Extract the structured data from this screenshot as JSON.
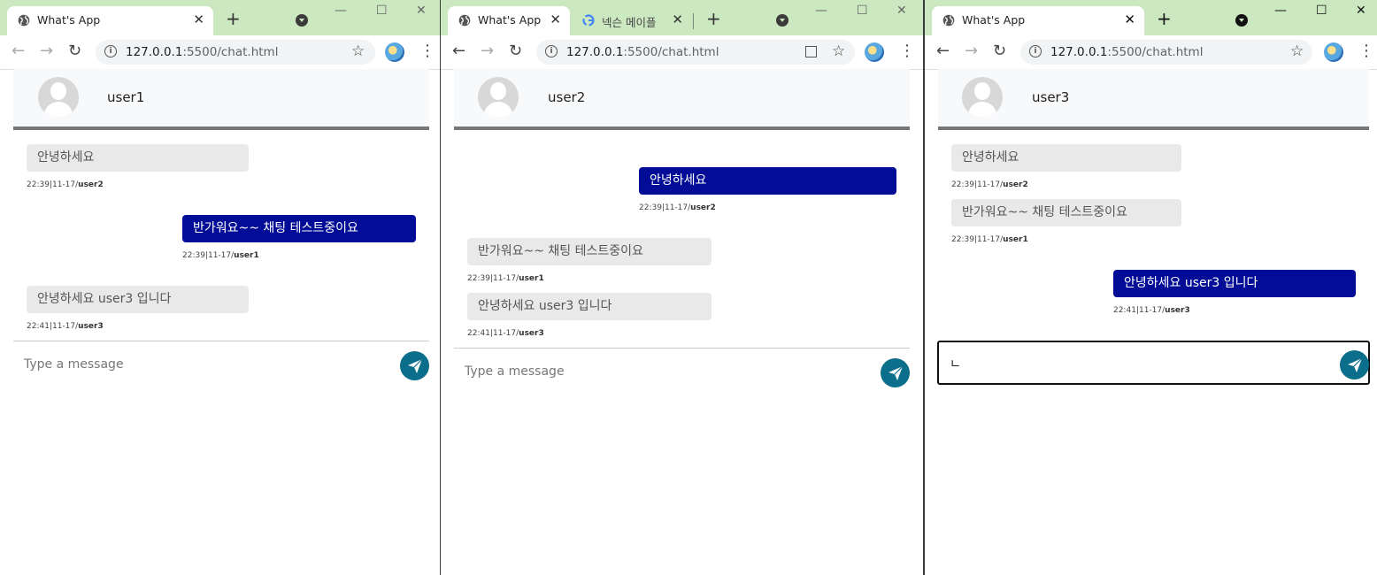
{
  "windows": [
    {
      "tabs": [
        {
          "title": "What's App",
          "close": "✕"
        }
      ],
      "url_host": "127.0.0.1",
      "url_rest": ":5500/chat.html",
      "user": "user1",
      "messages": [
        {
          "dir": "in",
          "text": "안녕하세요",
          "time": "22:39|11-17/",
          "sender": "user2"
        },
        {
          "dir": "out",
          "text": "반가워요~~ 채팅 테스트중이요",
          "time": "22:39|11-17/",
          "sender": "user1"
        },
        {
          "dir": "in",
          "text": "안녕하세요 user3 입니다",
          "time": "22:41|11-17/",
          "sender": "user3"
        }
      ],
      "input_value": "",
      "input_placeholder": "Type a message"
    },
    {
      "tabs": [
        {
          "title": "What's App",
          "close": "✕"
        },
        {
          "title": "넥슨 메이플",
          "close": "✕"
        }
      ],
      "url_host": "127.0.0.1",
      "url_rest": ":5500/chat.html",
      "user": "user2",
      "messages": [
        {
          "dir": "out",
          "text": "안녕하세요",
          "time": "22:39|11-17/",
          "sender": "user2"
        },
        {
          "dir": "in",
          "text": "반가워요~~ 채팅 테스트중이요",
          "time": "22:39|11-17/",
          "sender": "user1"
        },
        {
          "dir": "in",
          "text": "안녕하세요 user3 입니다",
          "time": "22:41|11-17/",
          "sender": "user3"
        }
      ],
      "input_value": "",
      "input_placeholder": "Type a message"
    },
    {
      "tabs": [
        {
          "title": "What's App",
          "close": "✕"
        }
      ],
      "url_host": "127.0.0.1",
      "url_rest": ":5500/chat.html",
      "user": "user3",
      "messages": [
        {
          "dir": "in",
          "text": "안녕하세요",
          "time": "22:39|11-17/",
          "sender": "user2"
        },
        {
          "dir": "in",
          "text": "반가워요~~ 채팅 테스트중이요",
          "time": "22:39|11-17/",
          "sender": "user1"
        },
        {
          "dir": "out",
          "text": "안녕하세요 user3 입니다",
          "time": "22:41|11-17/",
          "sender": "user3"
        }
      ],
      "input_value": "ㄴ",
      "input_placeholder": "Type a message"
    }
  ],
  "chrome": {
    "back_icon": "←",
    "forward_icon": "→",
    "reload_icon": "↻",
    "newtab_icon": "+",
    "star_icon": "☆",
    "kebab_icon": "⋮",
    "info_icon": "i",
    "minimize_icon": "—",
    "maximize_icon": "☐",
    "close_icon": "✕"
  },
  "colors": {
    "tabbar": "#cbe8c1",
    "outgoing_bubble": "#020c96",
    "incoming_bubble": "#e9e9e9",
    "send_button": "#0b6e8a"
  }
}
